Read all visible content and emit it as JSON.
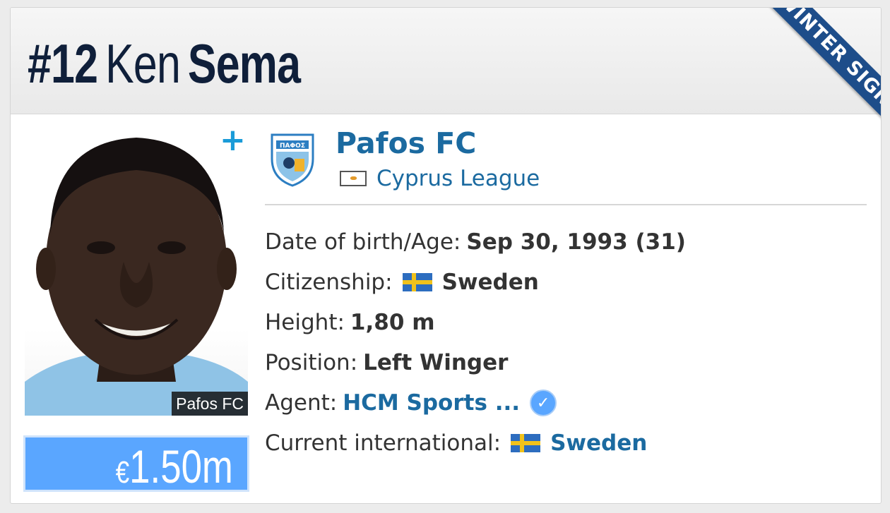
{
  "player": {
    "number": "#12",
    "first_name": "Ken",
    "last_name": "Sema",
    "ribbon": "WINTER SIGNING",
    "photo_caption": "Pafos FC",
    "market_value_currency": "€",
    "market_value_amount": "1.50m",
    "plus_icon": "+"
  },
  "club": {
    "name": "Pafos FC",
    "league": "Cyprus League",
    "logo_text": "ΠΑΦΟΣ"
  },
  "info": {
    "dob_label": "Date of birth/Age:",
    "dob_value": "Sep 30, 1993 (31)",
    "citizenship_label": "Citizenship:",
    "citizenship_value": "Sweden",
    "height_label": "Height:",
    "height_value": "1,80 m",
    "position_label": "Position:",
    "position_value": "Left Winger",
    "agent_label": "Agent:",
    "agent_value": "HCM Sports ...",
    "international_label": "Current international:",
    "international_value": "Sweden"
  },
  "icons": {
    "verified": "check-badge-icon",
    "flag": "sweden-flag-icon",
    "league_flag": "cyprus-flag-icon"
  },
  "colors": {
    "header_text": "#0f1f3a",
    "link": "#1b6aa0",
    "ribbon": "#1d4d8a",
    "value_box": "#5aa6ff",
    "plus": "#1a9bd8"
  }
}
